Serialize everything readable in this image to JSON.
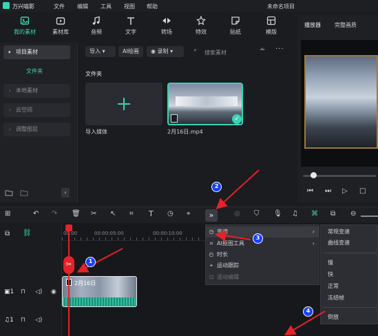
{
  "app": {
    "name": "万兴喵影",
    "project_title": "未命名项目"
  },
  "menubar": [
    "文件",
    "编辑",
    "工具",
    "视图",
    "帮助"
  ],
  "tabs": [
    {
      "label": "我的素材",
      "icon": "my-media-icon",
      "active": true
    },
    {
      "label": "素材库",
      "icon": "library-icon"
    },
    {
      "label": "音频",
      "icon": "music-note-icon"
    },
    {
      "label": "文字",
      "icon": "text-icon"
    },
    {
      "label": "转场",
      "icon": "transition-icon"
    },
    {
      "label": "特效",
      "icon": "effects-icon"
    },
    {
      "label": "贴纸",
      "icon": "sticker-icon"
    },
    {
      "label": "模版",
      "icon": "template-icon"
    }
  ],
  "left_panel": {
    "header": "项目素材",
    "folder": "文件夹",
    "items": [
      "本地素材",
      "云空间",
      "调整图层"
    ]
  },
  "media_toolbar": {
    "import": "导入",
    "ai_image": "AI绘画",
    "record": "录制",
    "search_placeholder": "搜索素材"
  },
  "media": {
    "folder_label": "文件夹",
    "import_label": "导入媒体",
    "clip_label": "2月16日.mp4"
  },
  "player": {
    "tab1": "播放器",
    "tab2": "完整画质"
  },
  "timeline": {
    "ticks": [
      "00:00",
      "00:00:05:00",
      "00:00:10:00"
    ],
    "clip_label": "2月16日"
  },
  "context_menu": {
    "items": [
      {
        "label": "变速",
        "highlight": true,
        "arrow": true
      },
      {
        "label": "AI抠图工具",
        "arrow": true
      },
      {
        "label": "时长"
      },
      {
        "label": "运动跟踪"
      },
      {
        "label": "混动编辑",
        "disabled": true
      }
    ]
  },
  "submenu": {
    "items": [
      "常规变速",
      "曲线变速",
      "慢",
      "快",
      "正常",
      "冻结帧",
      "倒放"
    ]
  },
  "annotations": [
    "1",
    "2",
    "3",
    "4"
  ],
  "colors": {
    "accent": "#39d4b5",
    "arrow": "#e4222a",
    "badge": "#1740ff"
  }
}
